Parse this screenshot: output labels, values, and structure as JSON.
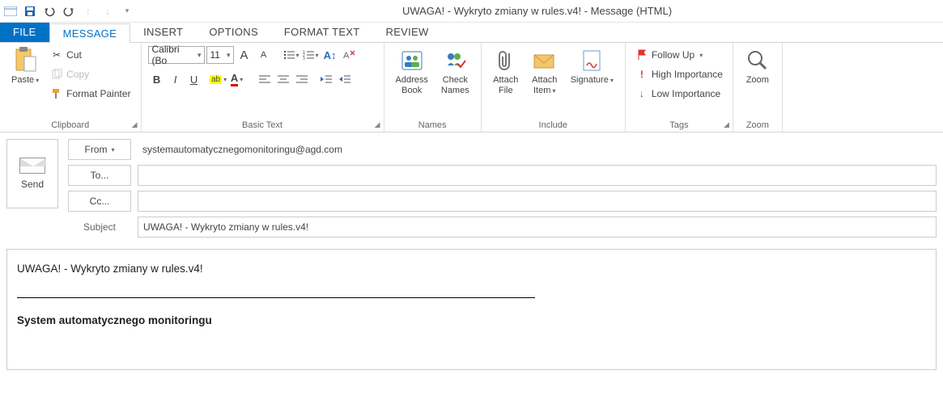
{
  "window": {
    "title": "UWAGA! - Wykryto zmiany w rules.v4! - Message (HTML)"
  },
  "tabs": {
    "file": "FILE",
    "message": "MESSAGE",
    "insert": "INSERT",
    "options": "OPTIONS",
    "formattext": "FORMAT TEXT",
    "review": "REVIEW"
  },
  "clipboard": {
    "paste": "Paste",
    "cut": "Cut",
    "copy": "Copy",
    "painter": "Format Painter",
    "group": "Clipboard"
  },
  "basictext": {
    "font": "Calibri (Bo",
    "size": "11",
    "group": "Basic Text"
  },
  "names": {
    "address": "Address\nBook",
    "check": "Check\nNames",
    "group": "Names"
  },
  "include": {
    "file": "Attach\nFile",
    "item": "Attach\nItem",
    "sig": "Signature",
    "group": "Include"
  },
  "tags": {
    "follow": "Follow Up",
    "high": "High Importance",
    "low": "Low Importance",
    "group": "Tags"
  },
  "zoom": {
    "zoom": "Zoom",
    "group": "Zoom"
  },
  "compose": {
    "send": "Send",
    "from_btn": "From",
    "from_val": "systemautomatycznegomonitoringu@agd.com",
    "to_btn": "To...",
    "to_val": "",
    "cc_btn": "Cc...",
    "cc_val": "",
    "subject_lbl": "Subject",
    "subject_val": "UWAGA! - Wykryto zmiany w rules.v4!"
  },
  "body": {
    "line1": "UWAGA! - Wykryto zmiany w rules.v4!",
    "sig": "System automatycznego monitoringu"
  }
}
